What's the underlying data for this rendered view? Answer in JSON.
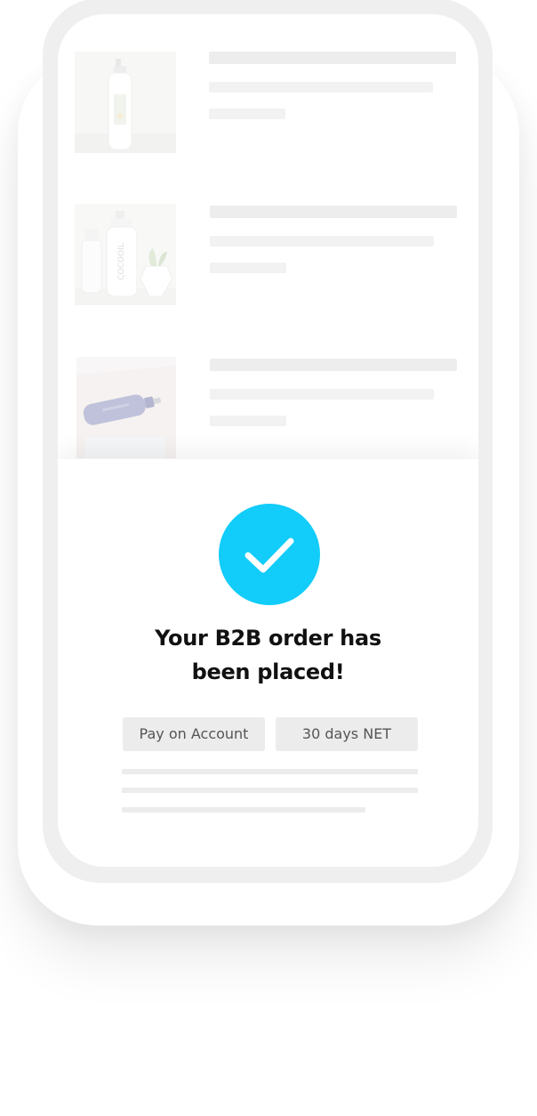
{
  "order_confirmation": {
    "title_line1": "Your B2B order has",
    "title_line2": "been placed!",
    "payment_method_label": "Pay on Account",
    "payment_terms_label": "30 days NET",
    "success_icon": "check-icon",
    "accent_color": "#12ccfa"
  },
  "product_list": {
    "items": [
      {
        "image": "white-lotion-bottle"
      },
      {
        "image": "cocooil-bottle-with-plant"
      },
      {
        "image": "lavender-spray-bottle"
      }
    ]
  },
  "brand_texts": {
    "bottle_brand": "COCOOIL"
  }
}
